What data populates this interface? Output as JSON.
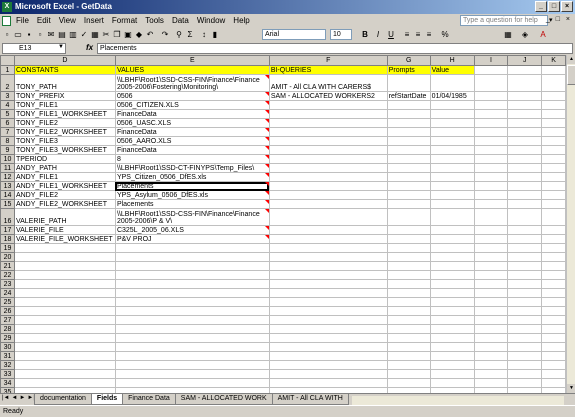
{
  "window": {
    "title": "Microsoft Excel - GetData",
    "app_icon": "X",
    "minimize": "_",
    "maximize": "□",
    "close": "×"
  },
  "menu": {
    "items": [
      "File",
      "Edit",
      "View",
      "Insert",
      "Format",
      "Tools",
      "Data",
      "Window",
      "Help"
    ],
    "help_placeholder": "Type a question for help",
    "help_arrow": "▾",
    "mdi_controls": "_ □ ×"
  },
  "toolbar": {
    "icons": [
      "new-icon",
      "open-icon",
      "save-icon",
      "permission-icon",
      "email-icon",
      "print-icon",
      "print-preview-icon",
      "spelling-icon",
      "research-icon",
      "cut-icon",
      "copy-icon",
      "paste-icon",
      "format-painter-icon",
      "undo-icon",
      "redo-icon",
      "hyperlink-icon",
      "autosum-icon",
      "sort-icon",
      "chart-icon"
    ],
    "zoom_value": "",
    "font_name": "Arial",
    "font_size": "10",
    "bold": "B",
    "italic": "I",
    "underline": "U"
  },
  "formula_bar": {
    "cell_ref": "E13",
    "fx": "fx",
    "content": "Placements"
  },
  "sheet": {
    "columns": [
      "D",
      "E",
      "F",
      "G",
      "H",
      "I",
      "J",
      "K"
    ],
    "rows": [
      {
        "n": "1",
        "tall": false,
        "d": "CONSTANTS",
        "e": "VALUES",
        "f": "BI-QUERIES",
        "g": "Prompts",
        "h": "Value"
      },
      {
        "n": "2",
        "tall": true,
        "d": "TONY_PATH",
        "e": "\\\\LBHF\\Root1\\SSD-CSS-FIN\\Finance\\Finance 2005-2006\\Fostering\\Monitoring\\",
        "f": "AMIT - All CLA WITH CARERS$",
        "g": "",
        "h": ""
      },
      {
        "n": "3",
        "tall": false,
        "d": "TONY_PREFIX",
        "e": "0506",
        "f": "SAM - ALLOCATED WORKERS2",
        "g": "refStartDate",
        "h": "01/04/1985"
      },
      {
        "n": "4",
        "tall": false,
        "d": "TONY_FILE1",
        "e": "0506_CITIZEN.XLS",
        "f": "",
        "g": "",
        "h": ""
      },
      {
        "n": "5",
        "tall": false,
        "d": "TONY_FILE1_WORKSHEET",
        "e": "FinanceData",
        "f": "",
        "g": "",
        "h": ""
      },
      {
        "n": "6",
        "tall": false,
        "d": "TONY_FILE2",
        "e": "0506_UASC.XLS",
        "f": "",
        "g": "",
        "h": ""
      },
      {
        "n": "7",
        "tall": false,
        "d": "TONY_FILE2_WORKSHEET",
        "e": "FinanceData",
        "f": "",
        "g": "",
        "h": ""
      },
      {
        "n": "8",
        "tall": false,
        "d": "TONY_FILE3",
        "e": "0506_AARO.XLS",
        "f": "",
        "g": "",
        "h": ""
      },
      {
        "n": "9",
        "tall": false,
        "d": "TONY_FILE3_WORKSHEET",
        "e": "FinanceData",
        "f": "",
        "g": "",
        "h": ""
      },
      {
        "n": "10",
        "tall": false,
        "d": "TPERIOD",
        "e": "8",
        "f": "",
        "g": "",
        "h": ""
      },
      {
        "n": "11",
        "tall": false,
        "d": "ANDY_PATH",
        "e": "\\\\LBHF\\Root1\\SSD-CT-FINYPS\\Temp_Files\\",
        "f": "",
        "g": "",
        "h": ""
      },
      {
        "n": "12",
        "tall": false,
        "d": "ANDY_FILE1",
        "e": "YPS_Citizen_0506_DfES.xls",
        "f": "",
        "g": "",
        "h": ""
      },
      {
        "n": "13",
        "tall": false,
        "d": "ANDY_FILE1_WORKSHEET",
        "e": "Placements",
        "f": "",
        "g": "",
        "h": ""
      },
      {
        "n": "14",
        "tall": false,
        "d": "ANDY_FILE2",
        "e": "YPS_Asylum_0506_DfES.xls",
        "f": "",
        "g": "",
        "h": ""
      },
      {
        "n": "15",
        "tall": false,
        "d": "ANDY_FILE2_WORKSHEET",
        "e": "Placements",
        "f": "",
        "g": "",
        "h": ""
      },
      {
        "n": "16",
        "tall": true,
        "d": "VALERIE_PATH",
        "e": "\\\\LBHF\\Root1\\SSD-CSS-FIN\\Finance\\Finance 2005-2006\\P & V\\",
        "f": "",
        "g": "",
        "h": ""
      },
      {
        "n": "17",
        "tall": false,
        "d": "VALERIE_FILE",
        "e": "C325L_2005_06.XLS",
        "f": "",
        "g": "",
        "h": ""
      },
      {
        "n": "18",
        "tall": false,
        "d": "VALERIE_FILE_WORKSHEET",
        "e": "P&V PROJ",
        "f": "",
        "g": "",
        "h": ""
      },
      {
        "n": "19",
        "tall": false,
        "d": "",
        "e": "",
        "f": "",
        "g": "",
        "h": ""
      },
      {
        "n": "20",
        "tall": false,
        "d": "",
        "e": "",
        "f": "",
        "g": "",
        "h": ""
      },
      {
        "n": "21",
        "tall": false,
        "d": "",
        "e": "",
        "f": "",
        "g": "",
        "h": ""
      },
      {
        "n": "22",
        "tall": false,
        "d": "",
        "e": "",
        "f": "",
        "g": "",
        "h": ""
      },
      {
        "n": "23",
        "tall": false,
        "d": "",
        "e": "",
        "f": "",
        "g": "",
        "h": ""
      },
      {
        "n": "24",
        "tall": false,
        "d": "",
        "e": "",
        "f": "",
        "g": "",
        "h": ""
      },
      {
        "n": "25",
        "tall": false,
        "d": "",
        "e": "",
        "f": "",
        "g": "",
        "h": ""
      },
      {
        "n": "26",
        "tall": false,
        "d": "",
        "e": "",
        "f": "",
        "g": "",
        "h": ""
      },
      {
        "n": "27",
        "tall": false,
        "d": "",
        "e": "",
        "f": "",
        "g": "",
        "h": ""
      },
      {
        "n": "28",
        "tall": false,
        "d": "",
        "e": "",
        "f": "",
        "g": "",
        "h": ""
      },
      {
        "n": "29",
        "tall": false,
        "d": "",
        "e": "",
        "f": "",
        "g": "",
        "h": ""
      },
      {
        "n": "30",
        "tall": false,
        "d": "",
        "e": "",
        "f": "",
        "g": "",
        "h": ""
      },
      {
        "n": "31",
        "tall": false,
        "d": "",
        "e": "",
        "f": "",
        "g": "",
        "h": ""
      },
      {
        "n": "32",
        "tall": false,
        "d": "",
        "e": "",
        "f": "",
        "g": "",
        "h": ""
      },
      {
        "n": "33",
        "tall": false,
        "d": "",
        "e": "",
        "f": "",
        "g": "",
        "h": ""
      },
      {
        "n": "34",
        "tall": false,
        "d": "",
        "e": "",
        "f": "",
        "g": "",
        "h": ""
      },
      {
        "n": "35",
        "tall": false,
        "d": "",
        "e": "",
        "f": "",
        "g": "",
        "h": ""
      }
    ]
  },
  "tabs": {
    "nav": [
      "|◄",
      "◄",
      "►",
      "►|"
    ],
    "items": [
      "documentation",
      "Fields",
      "Finance Data",
      "SAM - ALLOCATED WORK",
      "AMIT - All CLA WITH"
    ],
    "active": "Fields"
  },
  "status": "Ready",
  "colors": {
    "header_fill": "#ffff00",
    "title_bar": "#0a246a",
    "comment_marker": "#ff0000"
  }
}
